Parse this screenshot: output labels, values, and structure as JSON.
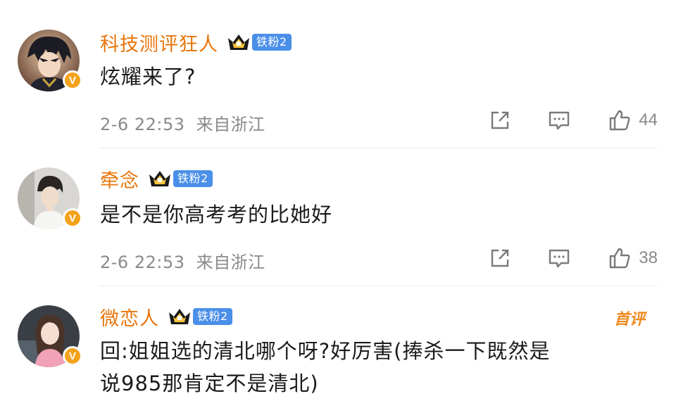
{
  "comments": [
    {
      "username": "科技测评狂人",
      "fan_badge": "铁粉2",
      "text": "炫耀来了?",
      "time": "2-6 22:53",
      "location": "来自浙江",
      "likes": "44"
    },
    {
      "username": "牵念",
      "fan_badge": "铁粉2",
      "text": "是不是你高考考的比她好",
      "time": "2-6 22:53",
      "location": "来自浙江",
      "likes": "38"
    },
    {
      "username": "微恋人",
      "fan_badge": "铁粉2",
      "first_tag": "首评",
      "text_line1": "回:姐姐选的清北哪个呀?好厉害(捧杀一下既然是",
      "text_line2": "说985那肯定不是清北)"
    }
  ],
  "colors": {
    "username": "#e8750b",
    "fan_badge": "#4a8fe8",
    "verified_badge": "#f5a21c",
    "meta_text": "#8a8a8a"
  },
  "icons": [
    "share-icon",
    "comment-icon",
    "like-icon",
    "crown-icon",
    "verified-icon"
  ]
}
